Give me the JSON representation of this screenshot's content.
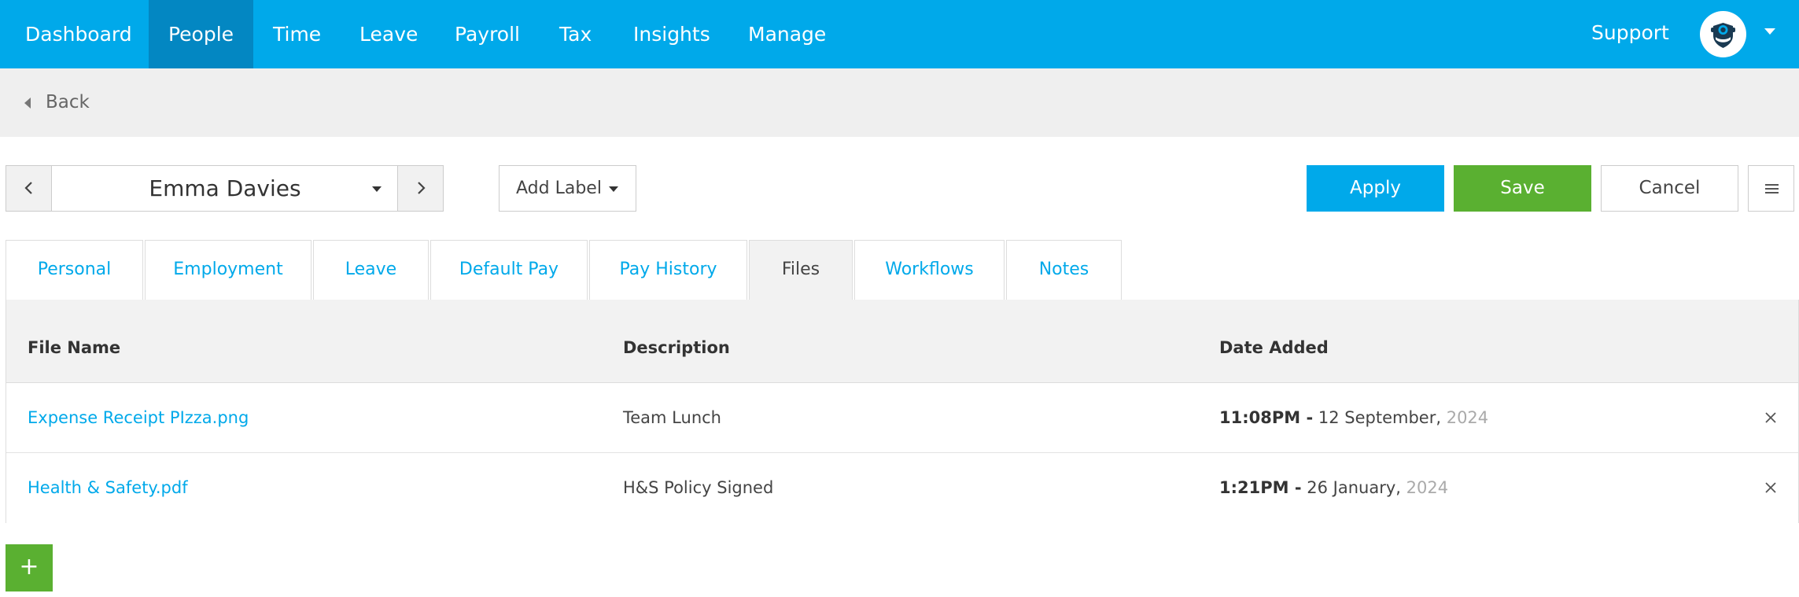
{
  "nav": {
    "items": [
      {
        "label": "Dashboard"
      },
      {
        "label": "People"
      },
      {
        "label": "Time"
      },
      {
        "label": "Leave"
      },
      {
        "label": "Payroll"
      },
      {
        "label": "Tax"
      },
      {
        "label": "Insights"
      },
      {
        "label": "Manage"
      }
    ],
    "active": "People",
    "support_label": "Support",
    "avatar_icon": "user-shield-icon"
  },
  "back": {
    "label": "Back"
  },
  "employee": {
    "name": "Emma Davies"
  },
  "add_label": {
    "label": "Add Label"
  },
  "actions": {
    "apply_label": "Apply",
    "save_label": "Save",
    "cancel_label": "Cancel",
    "menu_icon": "hamburger-menu-icon"
  },
  "tabs": [
    {
      "label": "Personal"
    },
    {
      "label": "Employment"
    },
    {
      "label": "Leave"
    },
    {
      "label": "Default Pay"
    },
    {
      "label": "Pay History"
    },
    {
      "label": "Files"
    },
    {
      "label": "Workflows"
    },
    {
      "label": "Notes"
    }
  ],
  "active_tab": "Files",
  "table": {
    "columns": [
      "File Name",
      "Description",
      "Date Added"
    ],
    "rows": [
      {
        "file": "Expense Receipt PIzza.png",
        "description": "Team Lunch",
        "time": "11:08PM -",
        "date": "12 September,",
        "year": "2024"
      },
      {
        "file": "Health & Safety.pdf",
        "description": "H&S Policy Signed",
        "time": "1:21PM -",
        "date": "26 January,",
        "year": "2024"
      }
    ]
  },
  "add_file": {
    "label": "+"
  },
  "colors": {
    "brand_blue": "#00a9ea",
    "active_nav": "#0387c2",
    "save_green": "#5ab031"
  }
}
